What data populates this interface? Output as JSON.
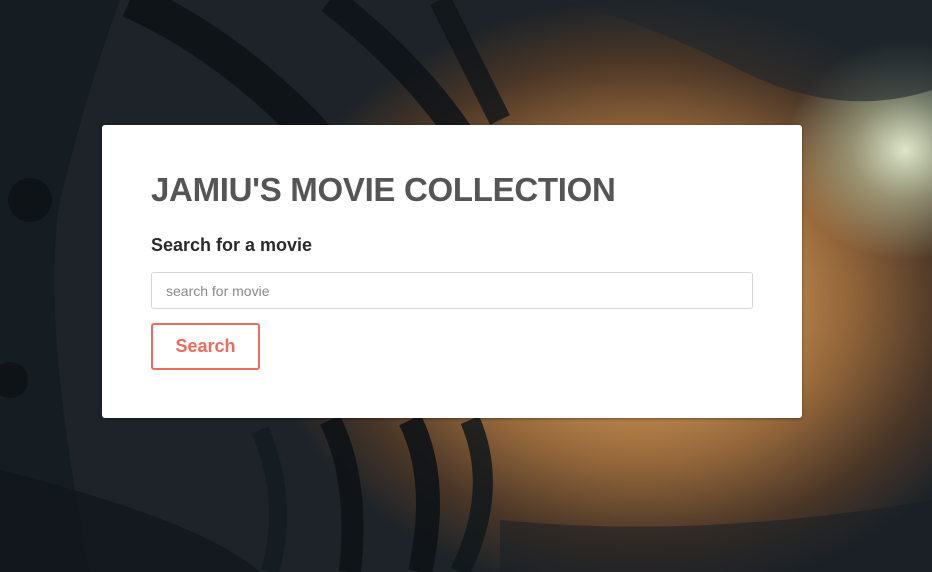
{
  "page": {
    "title": "JAMIU'S MOVIE COLLECTION",
    "search_label": "Search for a movie",
    "search_input": {
      "value": "",
      "placeholder": "search for movie"
    },
    "search_button_label": "Search"
  },
  "colors": {
    "accent": "#ef6b5c",
    "title_text": "#555555",
    "card_background": "#ffffff"
  }
}
